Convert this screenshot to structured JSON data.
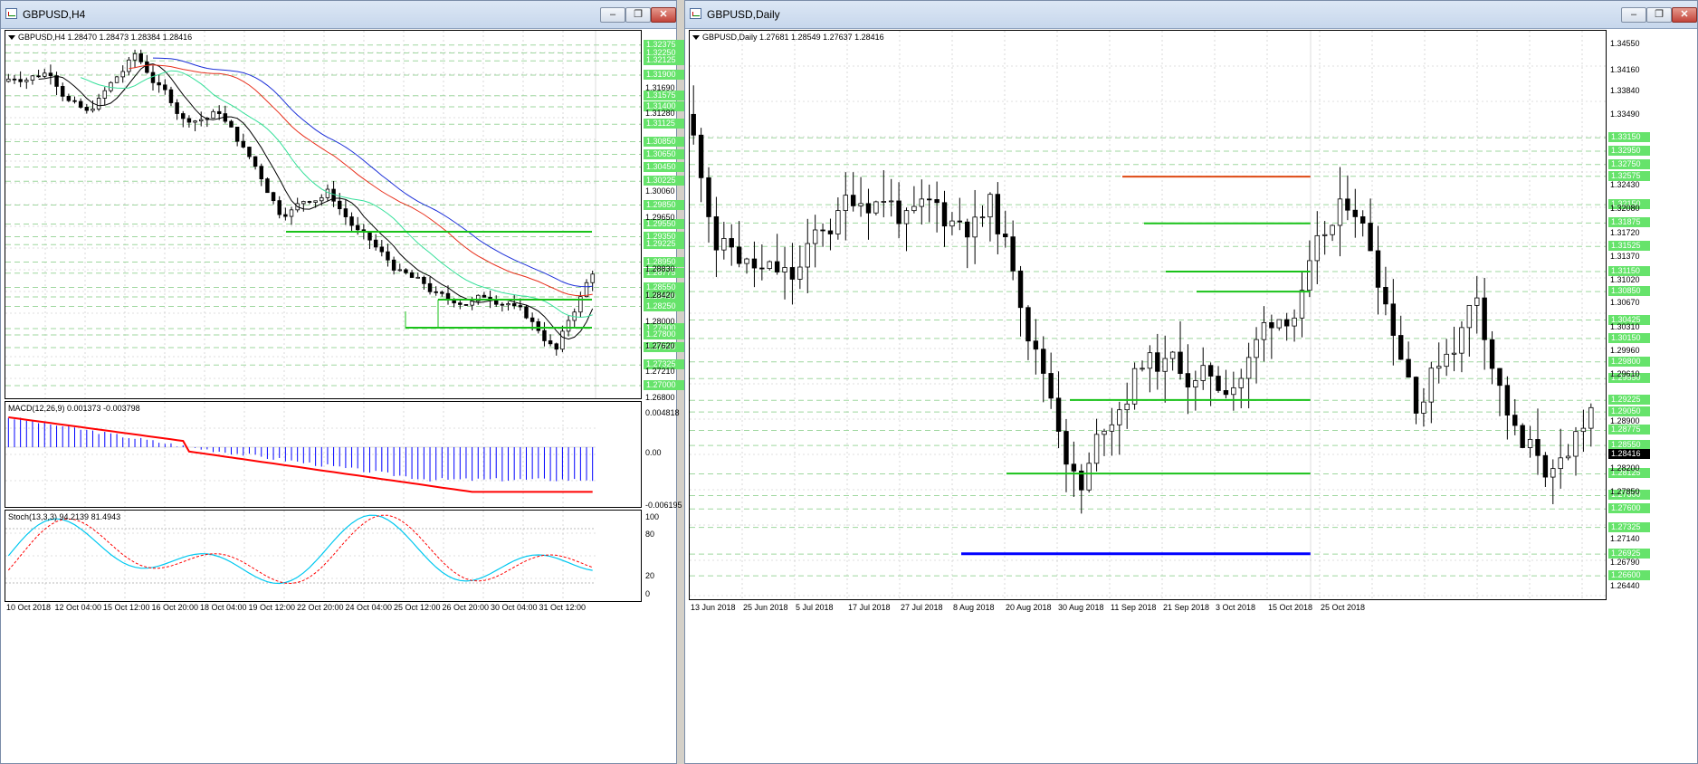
{
  "colors": {
    "grid": "#9fd79f",
    "bull": "#ffffff",
    "bear": "#000000",
    "support": "#19c219",
    "resistance": "#e04a14",
    "low_line": "#0000ff",
    "macd_hist": "#0000ff",
    "macd_signal": "#ff0000",
    "stoch_main": "#00c8f0",
    "stoch_signal": "#ff0000"
  },
  "left_window": {
    "title": "GBPUSD,H4",
    "info": "GBPUSD,H4  1.28470 1.28473 1.28384 1.28416",
    "macd_label": "MACD(12,26,9) 0.001373 -0.003798",
    "stoch_label": "Stoch(13,3,3) 94.2139 81.4943",
    "x_labels": [
      "10 Oct 2018",
      "12 Oct 04:00",
      "15 Oct 12:00",
      "16 Oct 20:00",
      "18 Oct 04:00",
      "19 Oct 12:00",
      "22 Oct 20:00",
      "24 Oct 04:00",
      "25 Oct 12:00",
      "26 Oct 20:00",
      "30 Oct 04:00",
      "31 Oct 12:00"
    ],
    "y_labels": [
      "1.31690",
      "1.31280",
      "1.30060",
      "1.29650",
      "1.28830",
      "1.28420",
      "1.28000",
      "1.27620",
      "1.27210",
      "1.26800"
    ],
    "level_labels": [
      "1.32375",
      "1.32250",
      "1.32125",
      "1.31900",
      "1.31575",
      "1.31400",
      "1.31125",
      "1.30850",
      "1.30650",
      "1.30450",
      "1.30225",
      "1.29850",
      "1.29550",
      "1.29350",
      "1.29225",
      "1.28950",
      "1.28775",
      "1.28550",
      "1.28400",
      "1.28250",
      "1.27900",
      "1.27800",
      "1.27600",
      "1.27325",
      "1.27000"
    ],
    "macd_axis": [
      "0.004818",
      "0.00",
      "-0.006195"
    ],
    "stoch_axis": [
      "100",
      "80",
      "20",
      "0"
    ]
  },
  "right_window": {
    "title": "GBPUSD,Daily",
    "info": "GBPUSD,Daily  1.27681 1.28549 1.27637 1.28416",
    "current_price": "1.28416",
    "x_labels": [
      "13 Jun 2018",
      "25 Jun 2018",
      "5 Jul 2018",
      "17 Jul 2018",
      "27 Jul 2018",
      "8 Aug 2018",
      "20 Aug 2018",
      "30 Aug 2018",
      "11 Sep 2018",
      "21 Sep 2018",
      "3 Oct 2018",
      "15 Oct 2018",
      "25 Oct 2018"
    ],
    "y_labels": [
      "1.34550",
      "1.34160",
      "1.33840",
      "1.33490",
      "1.32430",
      "1.32080",
      "1.31720",
      "1.31370",
      "1.31020",
      "1.30670",
      "1.30310",
      "1.29960",
      "1.29610",
      "1.28900",
      "1.28200",
      "1.27850",
      "1.27140",
      "1.26790",
      "1.26440"
    ],
    "level_labels": [
      "1.33150",
      "1.32950",
      "1.32750",
      "1.32575",
      "1.32150",
      "1.31875",
      "1.31525",
      "1.31150",
      "1.30850",
      "1.30425",
      "1.30150",
      "1.29800",
      "1.29550",
      "1.29225",
      "1.29050",
      "1.28775",
      "1.28550",
      "1.28125",
      "1.27800",
      "1.27600",
      "1.27325",
      "1.26925",
      "1.26600"
    ]
  },
  "window_buttons": {
    "minimize": "–",
    "restore": "❐",
    "close": "✕"
  }
}
